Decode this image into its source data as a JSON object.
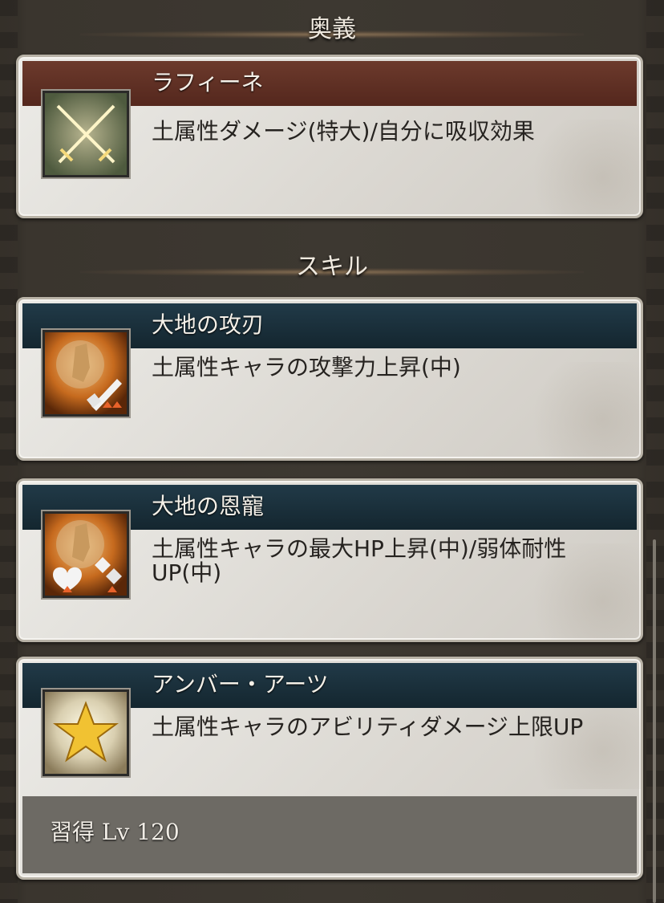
{
  "sections": {
    "ougi": {
      "title": "奥義"
    },
    "skill": {
      "title": "スキル"
    }
  },
  "ougi_card": {
    "name": "ラフィーネ",
    "description": "土属性ダメージ(特大)/自分に吸収効果",
    "icon": "crossed-swords-icon"
  },
  "skills": [
    {
      "name": "大地の攻刃",
      "description": "土属性キャラの攻撃力上昇(中)",
      "icon": "earth-attack-up-icon"
    },
    {
      "name": "大地の恩寵",
      "description": "土属性キャラの最大HP上昇(中)/弱体耐性UP(中)",
      "icon": "earth-hp-debuff-resist-icon"
    },
    {
      "name": "アンバー・アーツ",
      "description": "土属性キャラのアビリティダメージ上限UP",
      "icon": "star-icon",
      "learn_text": "習得 Lv 120"
    }
  ],
  "colors": {
    "ougi_band": "#5e2e22",
    "skill_band": "#1b303b",
    "card_bg": "#e3e1dc"
  }
}
